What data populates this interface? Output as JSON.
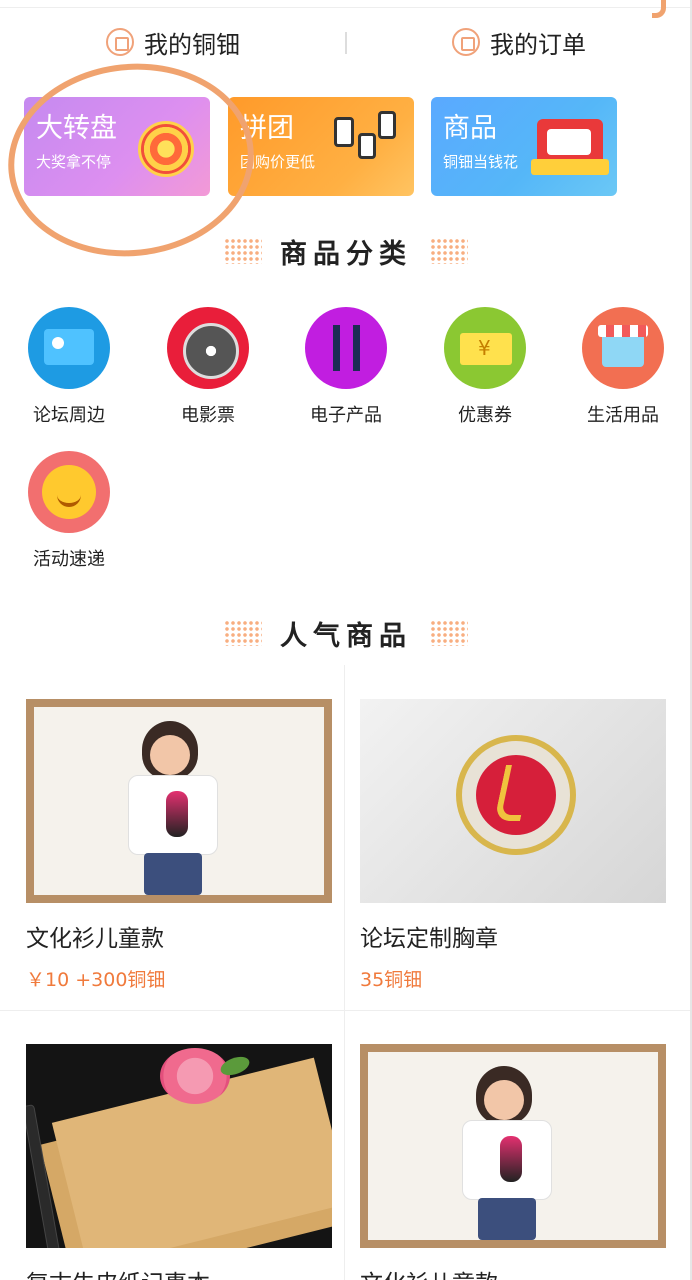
{
  "header": {
    "tabs": [
      {
        "label": "我的铜钿",
        "icon": "wallet-icon"
      },
      {
        "label": "我的订单",
        "icon": "order-icon"
      }
    ]
  },
  "banners": [
    {
      "title": "大转盘",
      "subtitle": "大奖拿不停",
      "icon": "prize-wheel-icon",
      "highlighted": true
    },
    {
      "title": "拼团",
      "subtitle": "团购价更低",
      "icon": "phones-icon"
    },
    {
      "title": "商品",
      "subtitle": "铜钿当钱花",
      "icon": "red-packet-icon"
    }
  ],
  "sections": {
    "categories_title": "商品分类",
    "popular_title": "人气商品"
  },
  "categories": [
    {
      "label": "论坛周边",
      "icon": "forum-merch-icon",
      "color": "#1e9be3"
    },
    {
      "label": "电影票",
      "icon": "film-reel-icon",
      "color": "#e91e3a"
    },
    {
      "label": "电子产品",
      "icon": "usb-cable-icon",
      "color": "#c11ee0"
    },
    {
      "label": "优惠券",
      "icon": "coupon-icon",
      "color": "#8bc832"
    },
    {
      "label": "生活用品",
      "icon": "shop-icon",
      "color": "#f26f52"
    },
    {
      "label": "活动速递",
      "icon": "smiley-icon",
      "color": "#f26f6f"
    }
  ],
  "products": [
    {
      "name": "文化衫儿童款",
      "price": "￥10 +300铜钿",
      "image": "kid-tshirt-photo"
    },
    {
      "name": "论坛定制胸章",
      "price": "35铜钿",
      "image": "badge-photo"
    },
    {
      "name": "复古牛皮纸记事本",
      "price": "",
      "image": "notebook-photo"
    },
    {
      "name": "文化衫儿童款",
      "price": "",
      "image": "kid-tshirt-photo"
    }
  ],
  "colors": {
    "accent": "#f07a3c",
    "annotation": "#f0a36f"
  }
}
